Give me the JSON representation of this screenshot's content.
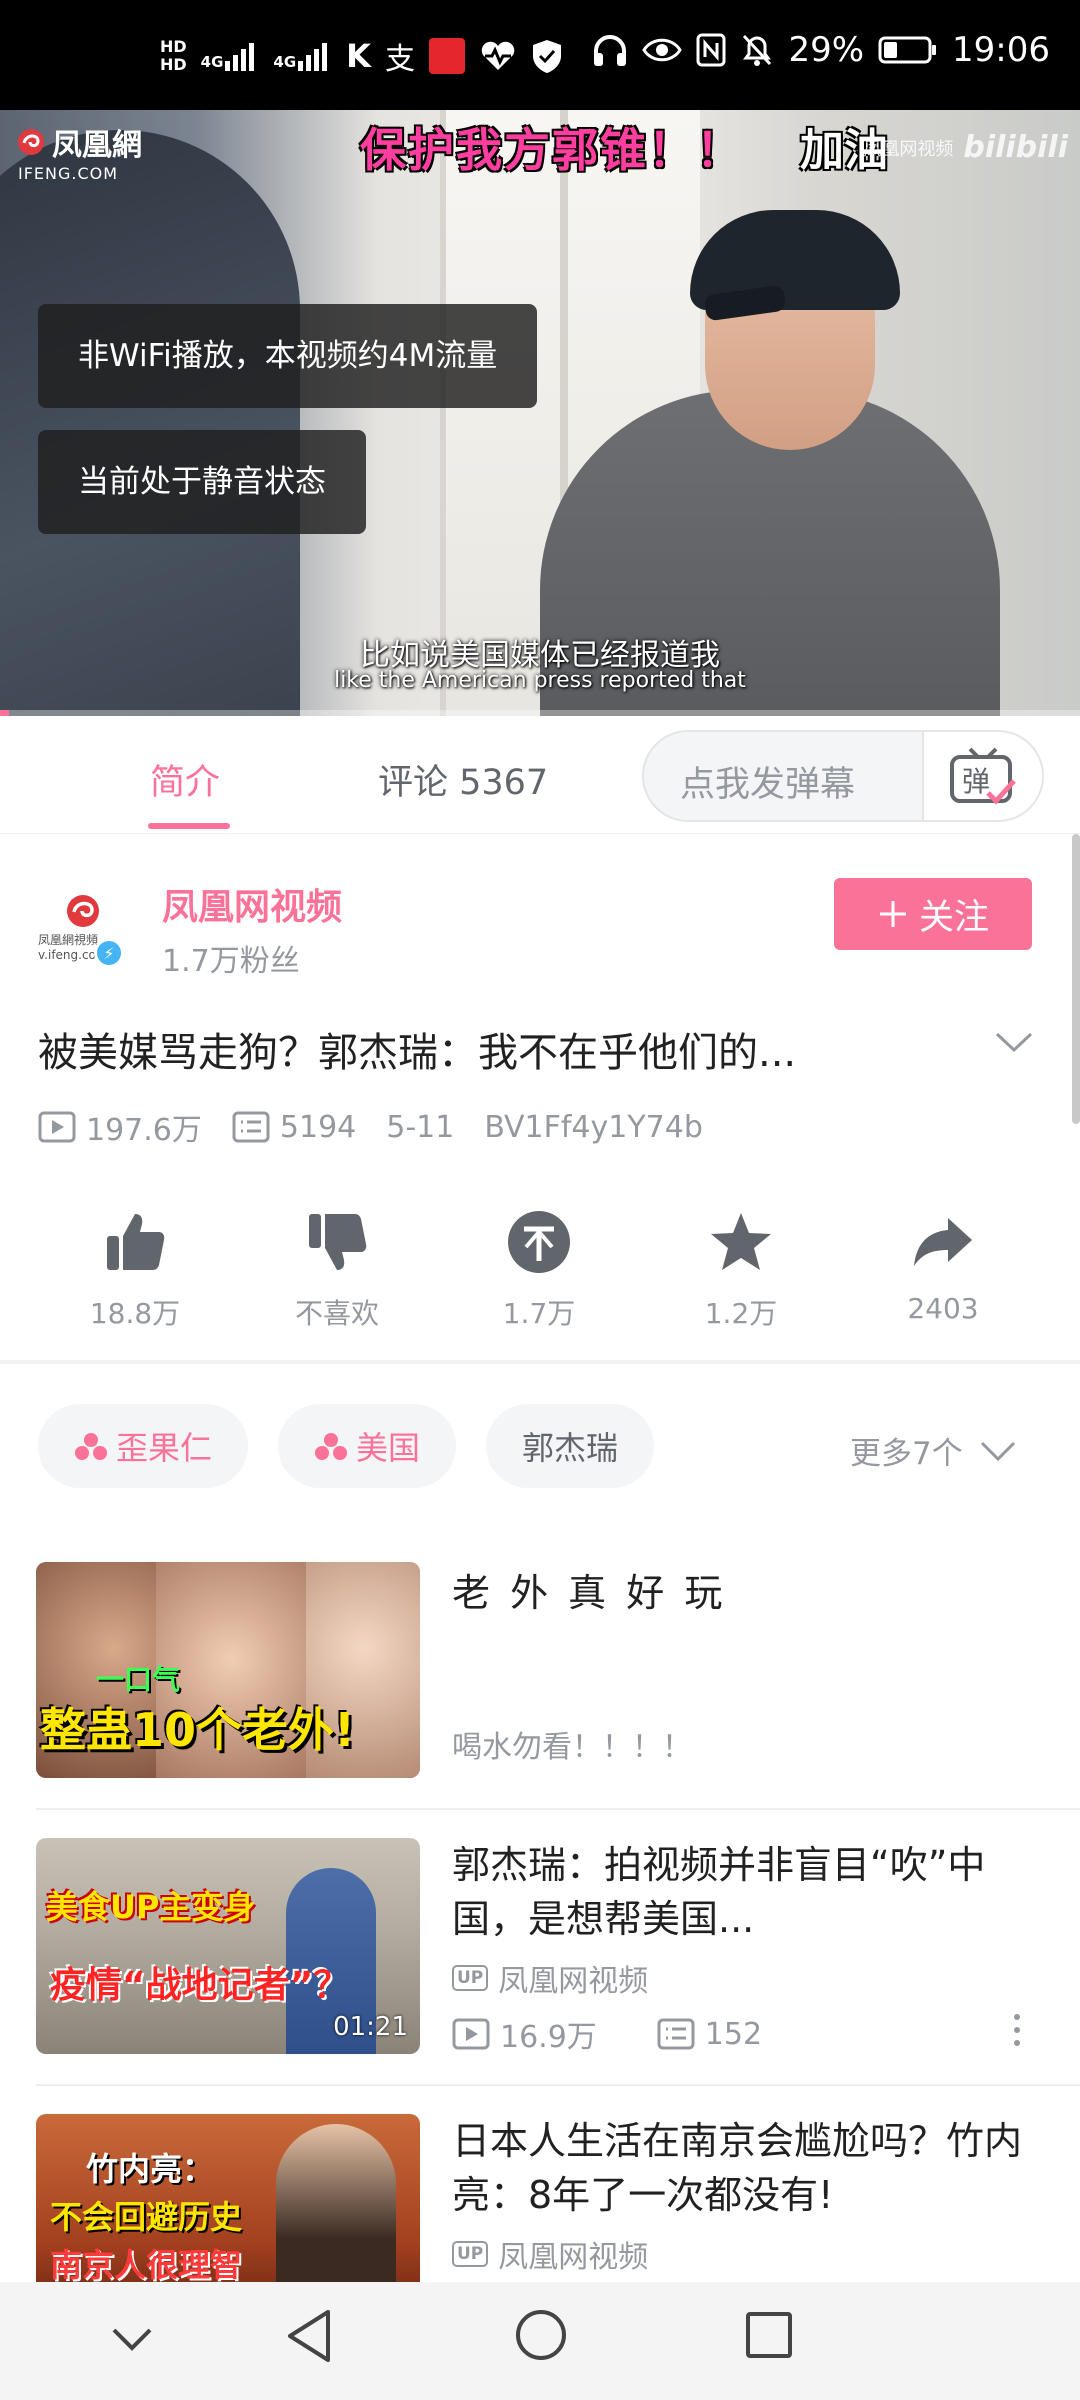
{
  "status_bar": {
    "hd1": "HD",
    "hd2": "HD",
    "net1": "4G",
    "net2": "4G",
    "battery": "29%",
    "time": "19:06"
  },
  "video": {
    "danmaku": [
      "保护我方郭锥！！",
      "加油"
    ],
    "logo_cn": "凤凰網",
    "logo_en": "IFENG.COM",
    "watermark": "凤凰网视频",
    "watermark_brand": "bilibili",
    "toasts": [
      "非WiFi播放，本视频约4M流量",
      "当前处于静音状态"
    ],
    "subtitle_cn": "比如说美国媒体已经报道我",
    "subtitle_en": "like the American press reported that",
    "progress": 0.008
  },
  "tabs": {
    "intro": "简介",
    "comments": "评论 5367",
    "danmaku_placeholder": "点我发弹幕",
    "danmaku_button": "弹"
  },
  "uploader": {
    "name": "凤凰网视频",
    "fans": "1.7万粉丝",
    "avatar_text": "凤凰網視頻 v.ifeng.com",
    "follow": "关注"
  },
  "video_info": {
    "title": "被美媒骂走狗？郭杰瑞：我不在乎他们的...",
    "views": "197.6万",
    "danmaku_count": "5194",
    "date": "5-11",
    "bvid": "BV1Ff4y1Y74b"
  },
  "actions": [
    {
      "icon": "thumbs-up-icon",
      "label": "18.8万"
    },
    {
      "icon": "thumbs-down-icon",
      "label": "不喜欢"
    },
    {
      "icon": "coin-icon",
      "label": "1.7万"
    },
    {
      "icon": "star-icon",
      "label": "1.2万"
    },
    {
      "icon": "share-icon",
      "label": "2403"
    }
  ],
  "tags": [
    "歪果仁",
    "美国",
    "郭杰瑞"
  ],
  "more_tags": "更多7个",
  "related": [
    {
      "title": "老 外 真 好 玩",
      "desc": "喝水勿看！！！！",
      "thumb_text_top": "一口气",
      "thumb_text_main": "整蛊10个老外!"
    },
    {
      "title": "郭杰瑞：拍视频并非盲目“吹”中国，是想帮美国...",
      "uploader": "凤凰网视频",
      "views": "16.9万",
      "danmaku": "152",
      "duration": "01:21",
      "thumb_text_top": "美食UP主变身",
      "thumb_text_main": "疫情“战地记者”？"
    },
    {
      "title": "日本人生活在南京会尴尬吗？竹内亮：8年了一次都没有!",
      "uploader": "凤凰网视频",
      "thumb_text_top": "竹内亮：",
      "thumb_text_mid": "不会回避历史",
      "thumb_text_main": "南京人很理智"
    }
  ],
  "badges": {
    "up": "UP"
  },
  "colors": {
    "accent": "#fb7299",
    "muted": "#9499a0",
    "text": "#212121"
  }
}
